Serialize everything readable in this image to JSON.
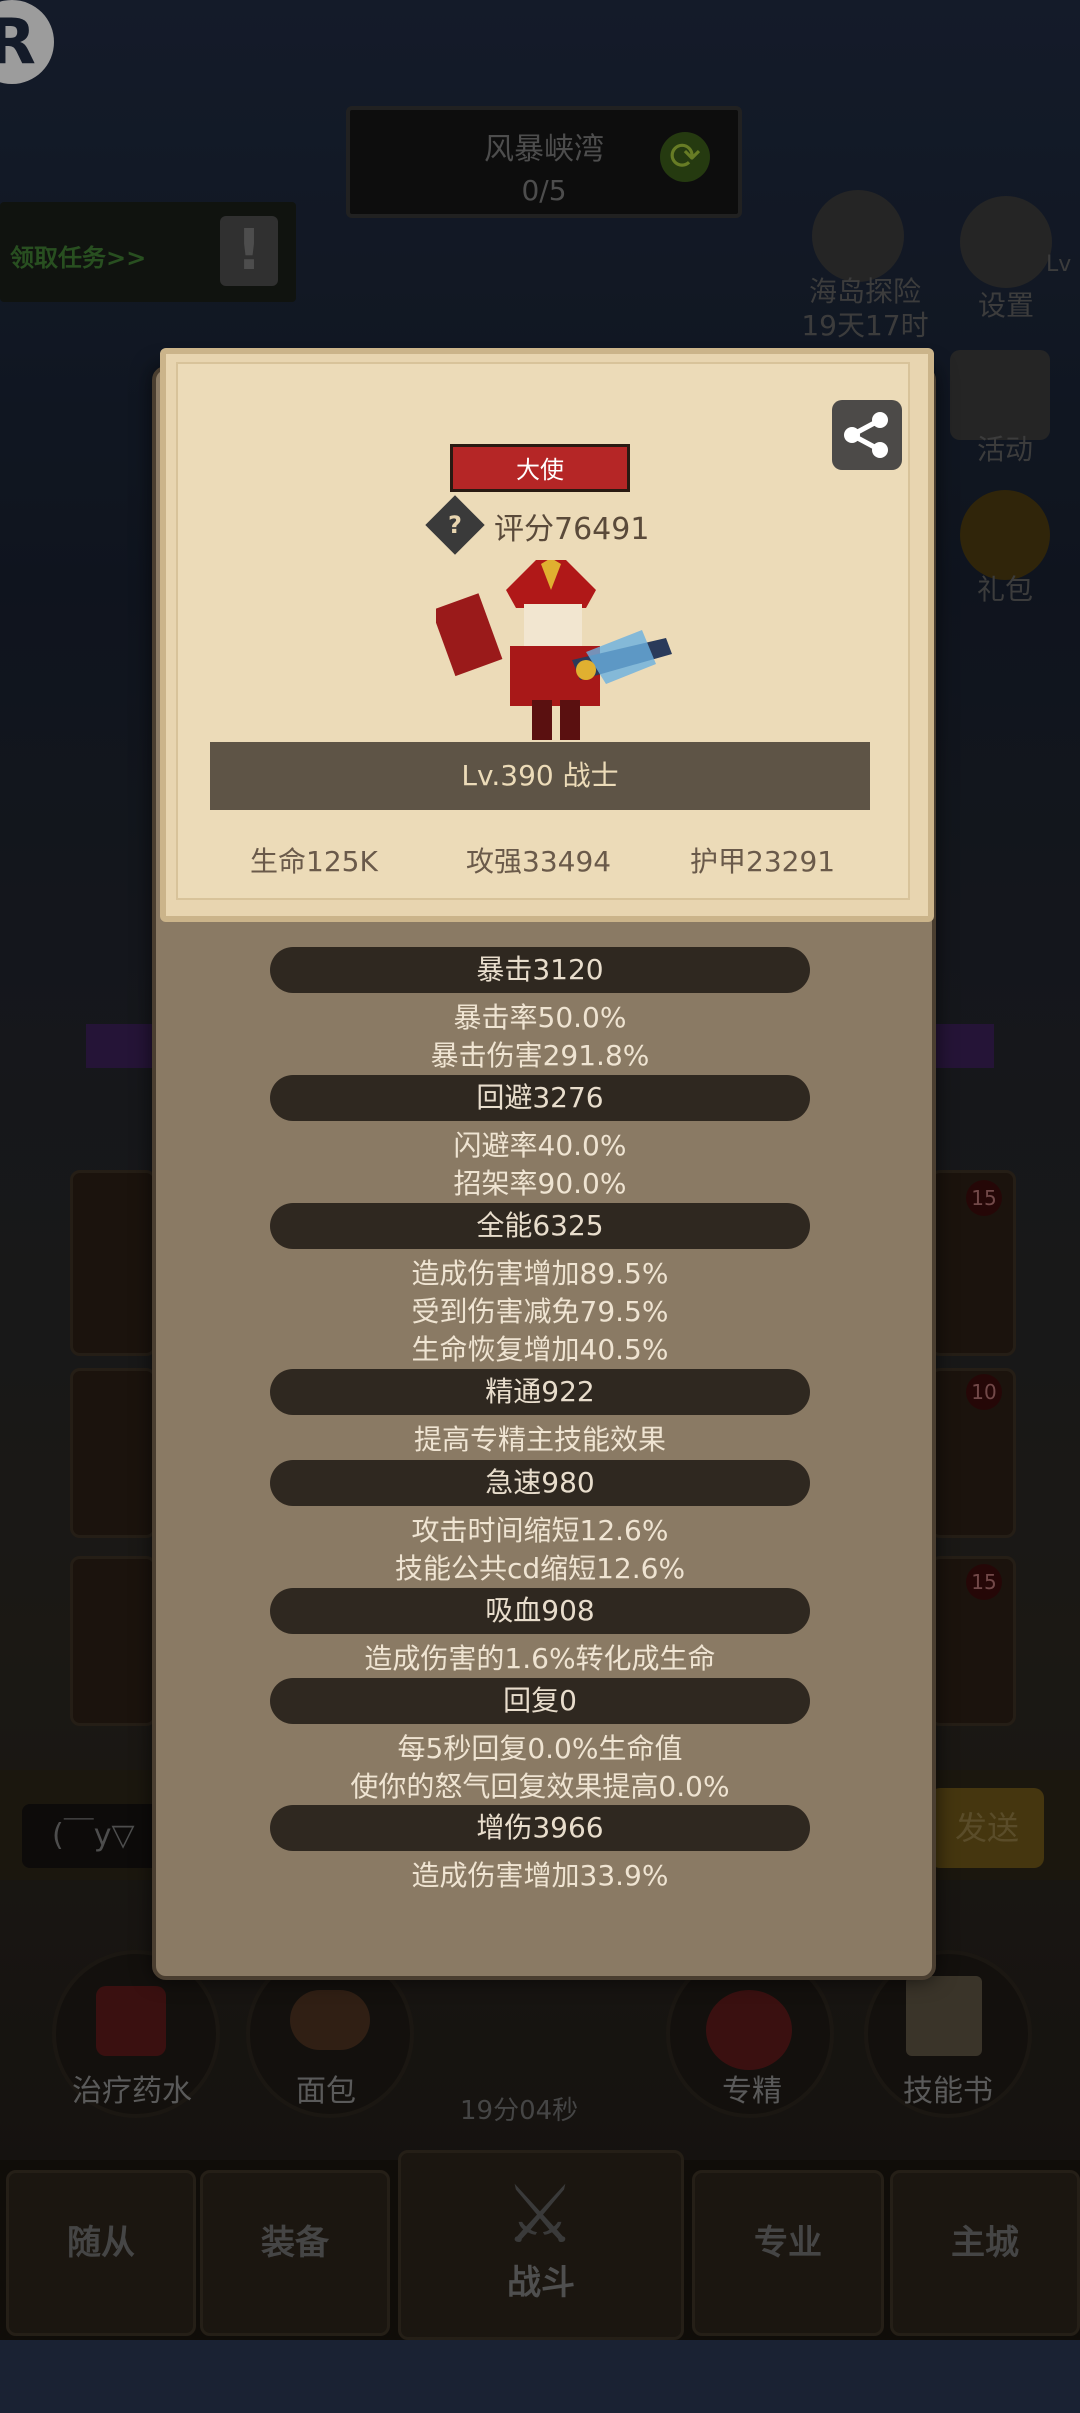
{
  "hud": {
    "logo": "R",
    "map_name": "风暴峡湾",
    "map_progress": "0/5",
    "quest_link": "领取任务>>",
    "quest_alert": "!",
    "island_label": "海岛探险",
    "island_timer": "19天17时",
    "settings_label": "设置",
    "level_cut": "Lv",
    "activity_label": "活动",
    "gift_label": "礼包"
  },
  "side": {
    "badge1": "15",
    "badge2": "10",
    "badge3": "15"
  },
  "chat": {
    "input_text": "(￣y▽",
    "send_label": "发送"
  },
  "actions": {
    "potion_label": "治疗药水",
    "bread_label": "面包",
    "timer": "19分04秒",
    "spec_label": "专精",
    "skillbook_label": "技能书"
  },
  "nav": {
    "followers": "随从",
    "equipment": "装备",
    "battle": "战斗",
    "profession": "专业",
    "main_city": "主城"
  },
  "profile": {
    "title_badge": "大使",
    "score": "评分76491",
    "level_class": "Lv.390 战士",
    "hp": "生命125K",
    "attack": "攻强33494",
    "armor": "护甲23291"
  },
  "stats": [
    {
      "head": "暴击3120",
      "lines": [
        "暴击率50.0%",
        "暴击伤害291.8%"
      ]
    },
    {
      "head": "回避3276",
      "lines": [
        "闪避率40.0%",
        "招架率90.0%"
      ]
    },
    {
      "head": "全能6325",
      "lines": [
        "造成伤害增加89.5%",
        "受到伤害减免79.5%",
        "生命恢复增加40.5%"
      ]
    },
    {
      "head": "精通922",
      "lines": [
        "提高专精主技能效果"
      ]
    },
    {
      "head": "急速980",
      "lines": [
        "攻击时间缩短12.6%",
        "技能公共cd缩短12.6%"
      ]
    },
    {
      "head": "吸血908",
      "lines": [
        "造成伤害的1.6%转化成生命"
      ]
    },
    {
      "head": "回复0",
      "lines": [
        "每5秒回复0.0%生命值",
        "使你的怒气回复效果提高0.0%"
      ]
    },
    {
      "head": "增伤3966",
      "lines": [
        "造成伤害增加33.9%"
      ]
    }
  ]
}
